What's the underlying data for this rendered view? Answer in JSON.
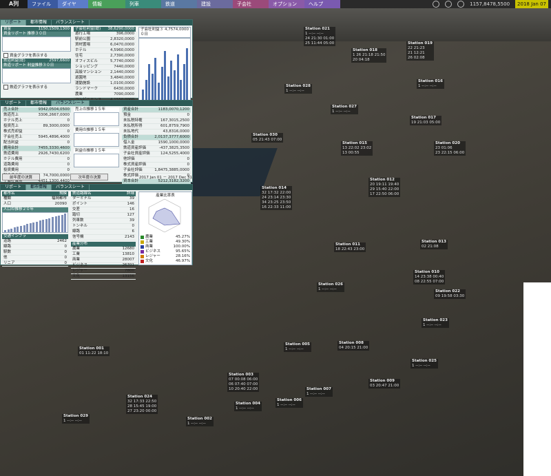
{
  "menu": {
    "logo": "A列",
    "items": [
      {
        "label": "ファイル",
        "color": "#3b5aa0"
      },
      {
        "label": "ダイヤ",
        "color": "#5c7cc9"
      },
      {
        "label": "情報",
        "color": "#4aa05a"
      },
      {
        "label": "列車",
        "color": "#3a8b7a"
      },
      {
        "label": "鉄道",
        "color": "#5a78a2"
      },
      {
        "label": "建設",
        "color": "#6b6b9e"
      },
      {
        "label": "子会社",
        "color": "#9b4a7a"
      },
      {
        "label": "オプション",
        "color": "#8a5aa8"
      },
      {
        "label": "ヘルプ",
        "color": "#7a5ab0"
      }
    ],
    "money": "1157,8478,5500",
    "date": "2018 Jan 07"
  },
  "panel1": {
    "tabs": [
      "リポート",
      "都市情報",
      "バランスシート"
    ],
    "fund_label": "資金",
    "fund_value": "1150,1509,1300",
    "fund_graph_title": "資金リポート 推移３０日",
    "show_fund_graph": "資金グラフを表示する",
    "rail_label": "鉄道利益(総)",
    "rail_value": "2597,6600",
    "rail_graph_title": "鉄道リポート 利益推移３０日",
    "show_rail_graph": "鉄道グラフを表示する",
    "sub_title": "子会社利益(総)",
    "sub_value": "38,6290,0000",
    "sub_rows": [
      [
        "遊行工場",
        "396,0000"
      ],
      [
        "駅前公園",
        "2,8320,0000"
      ],
      [
        "資材置場",
        "6,0470,0000"
      ],
      [
        "ホテル",
        "4,5960,0000"
      ],
      [
        "住宅",
        "2,7390,0000"
      ],
      [
        "オフィスビル",
        "5,7740,0000"
      ],
      [
        "ショッピング",
        "7440,0000"
      ],
      [
        "高級マンション",
        "2,1440,0000"
      ],
      [
        "遊園地",
        "3,4840,0000"
      ],
      [
        "運動施設",
        "1,0100,0000"
      ],
      [
        "ランドマーク",
        "6430,0000"
      ],
      [
        "農業",
        "7090,0000"
      ],
      [
        "コンビニエンス",
        "4,1550,0000"
      ],
      [
        "",
        "0"
      ],
      [
        "",
        "0"
      ],
      [
        "スキー場",
        "2,3050,0000"
      ]
    ],
    "sub_graph_title": "子会社利益３０日",
    "sub_graph_value": "4,7574,0000"
  },
  "panel2": {
    "tabs": [
      "リポート",
      "都市情報",
      "バランスシート"
    ],
    "left_rows": [
      [
        "売上合計",
        "9342,0504,0500"
      ],
      [
        "鉄道売上",
        "3306,2667,0000"
      ],
      [
        "ホテル売上",
        "0"
      ],
      [
        "投資売上",
        "89,3000,0000"
      ],
      [
        "株式売却益",
        "0"
      ],
      [
        "子会社売上",
        "5945,4896,4000"
      ],
      [
        "配当利益",
        "0"
      ],
      [
        "費用合計",
        "7455,3330,4600"
      ],
      [
        "鉄道費用",
        "2926,7430,6200"
      ],
      [
        "ホテル費用",
        "0"
      ],
      [
        "道路費用",
        "0"
      ],
      [
        "投資費用",
        "0"
      ],
      [
        "税金その他",
        "74,7000,0000"
      ],
      [
        "子会社費用",
        "4451,1300,4400"
      ],
      [
        "広告投資",
        "0"
      ],
      [
        "利益合計",
        "16,4000,0000"
      ],
      [
        "",
        ""
      ]
    ],
    "chart1_title": "売上の推移１５年",
    "chart2_title": "費用の推移１５年",
    "chart3_title": "利益の推移１５年",
    "right_rows": [
      [
        "資産合計",
        "1183,0070,1200"
      ],
      [
        "預金",
        "0"
      ],
      [
        "未払税特権",
        "167,3015,2500"
      ],
      [
        "未払税所得",
        "601,8759,7900"
      ],
      [
        "未払地代",
        "43,8316,0000"
      ],
      [
        "負債合計",
        "2,0137,3777,6000"
      ],
      [
        "借入金",
        "1590,1000,0000"
      ],
      [
        "鉄道資産評価",
        "-437,3825,3500"
      ],
      [
        "子会社資産評価",
        "124,5255,4000"
      ],
      [
        "他評価",
        "0"
      ],
      [
        "株式資産評価",
        "0"
      ],
      [
        "子会社評価",
        "1,8475,3885,0000"
      ],
      [
        "株式評価",
        "0"
      ],
      [
        "資本合計",
        "5212,3182,3200"
      ],
      [
        "資本金",
        "700,0000,0000"
      ],
      [
        "資本剰余金",
        "5212,3182,3200"
      ],
      [
        "",
        ""
      ]
    ],
    "buttons": [
      "前年度の決算",
      "次年度の決算"
    ],
    "period": "2017 Jan 01 － 2017 Dec 31"
  },
  "panel3": {
    "tabs": [
      "リポート",
      "都市情報",
      "バランスシート"
    ],
    "city_head": "都市名",
    "city_head2": "規模",
    "city_rows": [
      [
        "種類",
        "福岡都市"
      ],
      [
        "人口",
        "20090"
      ]
    ],
    "pop_graph_title": "人口の推移２０年",
    "infra_title": "交通インフラ",
    "infra_rows": [
      [
        "道路",
        "2462"
      ],
      [
        "線路",
        "0"
      ],
      [
        "駅数",
        "0"
      ],
      [
        "他",
        "0"
      ],
      [
        "リニア",
        "0"
      ]
    ],
    "rail_head": "鉄道路線名",
    "rail_head2": "詳細",
    "rail_rows": [
      [
        "ターミナル",
        "39"
      ],
      [
        "ポイント",
        "146"
      ],
      [
        "交差",
        "16"
      ],
      [
        "踏切",
        "127"
      ],
      [
        "列車数",
        "39"
      ],
      [
        "トンネル",
        "0"
      ],
      [
        "線路",
        "6"
      ],
      [
        "信号機",
        "2143"
      ]
    ],
    "ind_head": "産業分布",
    "ind_rows": [
      [
        "農業",
        "12680"
      ],
      [
        "工業",
        "13810"
      ],
      [
        "商業",
        "28007"
      ],
      [
        "ビジネス",
        "26701"
      ],
      [
        "レジャー",
        "7800"
      ],
      [
        "文化",
        "13156"
      ]
    ],
    "radar_title": "産業比率表",
    "legend": [
      {
        "label": "農業",
        "pct": "45.27%",
        "color": "#2a8a2a"
      },
      {
        "label": "工業",
        "pct": "49.30%",
        "color": "#c8a800"
      },
      {
        "label": "商業",
        "pct": "100.00%",
        "color": "#2a40a0"
      },
      {
        "label": "ビジネス",
        "pct": "95.65%",
        "color": "#7a2aa0"
      },
      {
        "label": "レジャー",
        "pct": "28.16%",
        "color": "#d07a00"
      },
      {
        "label": "文化",
        "pct": "46.97%",
        "color": "#c02020"
      }
    ]
  },
  "stations": [
    {
      "name": "Station 021",
      "rows": [
        "1 --:-- --:--",
        "24 21:30 01:00",
        "25 11:44 05:00"
      ]
    },
    {
      "name": "Station 018",
      "rows": [
        "1 26 21:18 21:50",
        "20 04:18"
      ]
    },
    {
      "name": "Station 019",
      "rows": [
        "22 21:23",
        "21 12:21",
        "26 02:08"
      ]
    },
    {
      "name": "Station 028",
      "rows": [
        "1 --:-- --:--"
      ]
    },
    {
      "name": "Station 016",
      "rows": [
        "1 --:-- --:--"
      ]
    },
    {
      "name": "Station 027",
      "rows": [
        "1 --:-- --:--"
      ]
    },
    {
      "name": "Station 017",
      "rows": [
        "19 21:03 05:00"
      ]
    },
    {
      "name": "Station 030",
      "rows": [
        "05 21:43 07:00"
      ]
    },
    {
      "name": "Station 015",
      "rows": [
        "13 22:02 23:02",
        "13 00:55"
      ]
    },
    {
      "name": "Station 020",
      "rows": [
        "23 01:06",
        "23 22:15 06:00"
      ]
    },
    {
      "name": "Station 014",
      "rows": [
        "32 17:32 22:00",
        "24 23:14 23:30",
        "34 23:25 23:50",
        "16 22:33 11:00"
      ]
    },
    {
      "name": "Station 012",
      "rows": [
        "20 19:11 19:40",
        "29 15:40 22:00",
        "17 22:50 06:00"
      ]
    },
    {
      "name": "Station 013",
      "rows": [
        "02 21:08"
      ]
    },
    {
      "name": "Station 011",
      "rows": [
        "18 22:43 23:00"
      ]
    },
    {
      "name": "Station 010",
      "rows": [
        "14 23:38 00:40",
        "08 22:55 07:00"
      ]
    },
    {
      "name": "Station 026",
      "rows": [
        "1 --:-- --:--"
      ]
    },
    {
      "name": "Station 022",
      "rows": [
        "09 19:58 03:30"
      ]
    },
    {
      "name": "Station 023",
      "rows": [
        "1 --:-- --:--"
      ]
    },
    {
      "name": "Station 001",
      "rows": [
        "01 11:22 18:10"
      ]
    },
    {
      "name": "Station 005",
      "rows": [
        "1 --:-- --:--"
      ]
    },
    {
      "name": "Station 008",
      "rows": [
        "04 20:15 21:00"
      ]
    },
    {
      "name": "Station 003",
      "rows": [
        "07 00:08 06:00",
        "06 07:40 07:00",
        "10 20:40 22:00"
      ]
    },
    {
      "name": "Station 025",
      "rows": [
        "1 --:-- --:--"
      ]
    },
    {
      "name": "Station 009",
      "rows": [
        "03 20:47 21:00"
      ]
    },
    {
      "name": "Station 007",
      "rows": [
        "1 --:-- --:--"
      ]
    },
    {
      "name": "Station 024",
      "rows": [
        "32 17:33 22:50",
        "28 15:45 19:00",
        "27 23:20 00:00"
      ]
    },
    {
      "name": "Station 004",
      "rows": [
        "1 --:-- --:--"
      ]
    },
    {
      "name": "Station 006",
      "rows": [
        "1 --:-- --:--"
      ]
    },
    {
      "name": "Station 002",
      "rows": [
        "1 --:-- --:--"
      ]
    },
    {
      "name": "Station 029",
      "rows": [
        "1 --:-- --:--"
      ]
    }
  ]
}
